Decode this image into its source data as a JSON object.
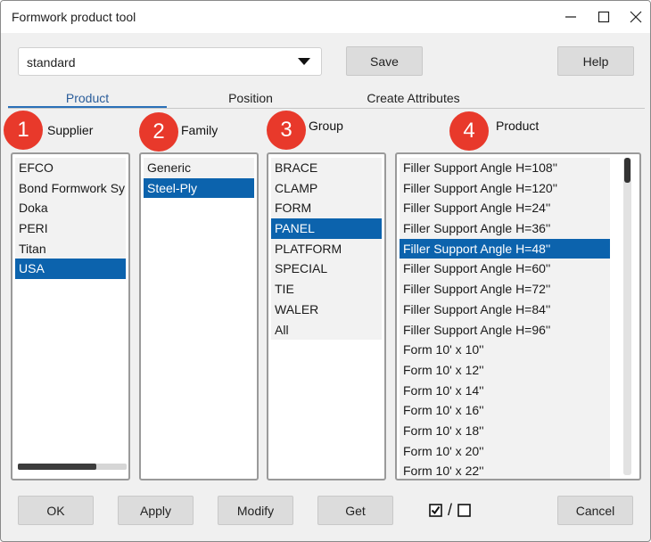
{
  "window": {
    "title": "Formwork product tool"
  },
  "toolbar": {
    "preset_value": "standard",
    "save_label": "Save",
    "help_label": "Help"
  },
  "tabs": [
    {
      "label": "Product",
      "active": true
    },
    {
      "label": "Position",
      "active": false
    },
    {
      "label": "Create Attributes",
      "active": false
    }
  ],
  "columns": {
    "supplier": {
      "badge": "1",
      "label": "Supplier",
      "items": [
        "EFCO",
        "Bond Formwork Sy",
        "Doka",
        "PERI",
        "Titan",
        "USA"
      ],
      "selected": "USA"
    },
    "family": {
      "badge": "2",
      "label": "Family",
      "items": [
        "Generic",
        "Steel-Ply"
      ],
      "selected": "Steel-Ply"
    },
    "group": {
      "badge": "3",
      "label": "Group",
      "items": [
        "BRACE",
        "CLAMP",
        "FORM",
        "PANEL",
        "PLATFORM",
        "SPECIAL",
        "TIE",
        "WALER",
        "All"
      ],
      "selected": "PANEL"
    },
    "product": {
      "badge": "4",
      "label": "Product",
      "items": [
        "Filler Support Angle H=108''",
        "Filler Support Angle H=120''",
        "Filler Support Angle H=24''",
        "Filler Support Angle H=36''",
        "Filler Support Angle H=48''",
        "Filler Support Angle H=60''",
        "Filler Support Angle H=72''",
        "Filler Support Angle H=84''",
        "Filler Support Angle H=96''",
        "Form 10' x 10''",
        "Form 10' x 12''",
        "Form 10' x 14''",
        "Form 10' x 16''",
        "Form 10' x 18''",
        "Form 10' x 20''",
        "Form 10' x 22''"
      ],
      "selected": "Filler Support Angle H=48''"
    }
  },
  "bottom": {
    "ok_label": "OK",
    "apply_label": "Apply",
    "modify_label": "Modify",
    "get_label": "Get",
    "cancel_label": "Cancel",
    "check_separator": "/"
  },
  "colors": {
    "selection": "#0c63ad",
    "badge": "#e8392b",
    "active_tab": "#2a70b8"
  }
}
